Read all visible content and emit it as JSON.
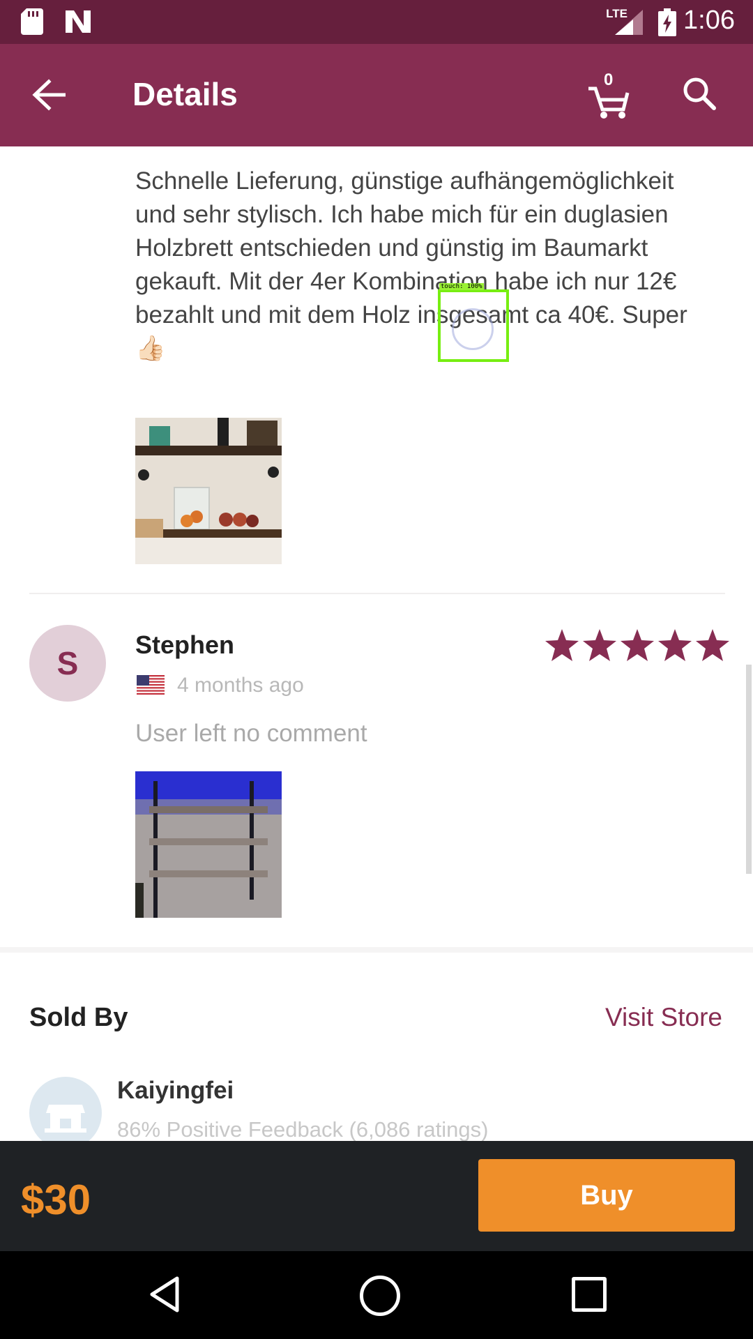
{
  "status_bar": {
    "time": "1:06",
    "network": "LTE",
    "icons": [
      "sd-card-icon",
      "n-logo-icon",
      "signal-icon",
      "battery-charging-icon"
    ]
  },
  "app_bar": {
    "title": "Details",
    "cart_count": "0",
    "icons": [
      "back-arrow-icon",
      "cart-icon",
      "search-icon"
    ]
  },
  "reviews": [
    {
      "comment": "Schnelle Lieferung, günstige aufhängemöglichkeit und sehr stylisch. Ich habe mich für ein duglasien Holzbrett entschieden und günstig im Baumarkt gekauft. Mit der 4er Kombination habe ich nur 12€ bezahlt und mit dem Holz insgesamt ca 40€. Super 👍🏻",
      "photo": "shelf-with-fruit-photo"
    },
    {
      "avatar_initial": "S",
      "name": "Stephen",
      "country_flag": "us-flag-icon",
      "time_ago": "4 months ago",
      "rating": 5,
      "comment": "User left no comment",
      "photo": "wall-shelves-blue-light-photo"
    }
  ],
  "seller": {
    "section_title": "Sold By",
    "visit_label": "Visit Store",
    "name": "Kaiyingfei",
    "feedback": "86% Positive Feedback (6,086 ratings)"
  },
  "purchase": {
    "price": "$30",
    "buy_label": "Buy"
  },
  "touch_overlay": {
    "label": "touch: 100%"
  },
  "colors": {
    "status_bar": "#661f3d",
    "app_bar": "#872d52",
    "accent": "#872d52",
    "buy": "#ef8f2a",
    "bottom_bar": "#1f2225"
  }
}
